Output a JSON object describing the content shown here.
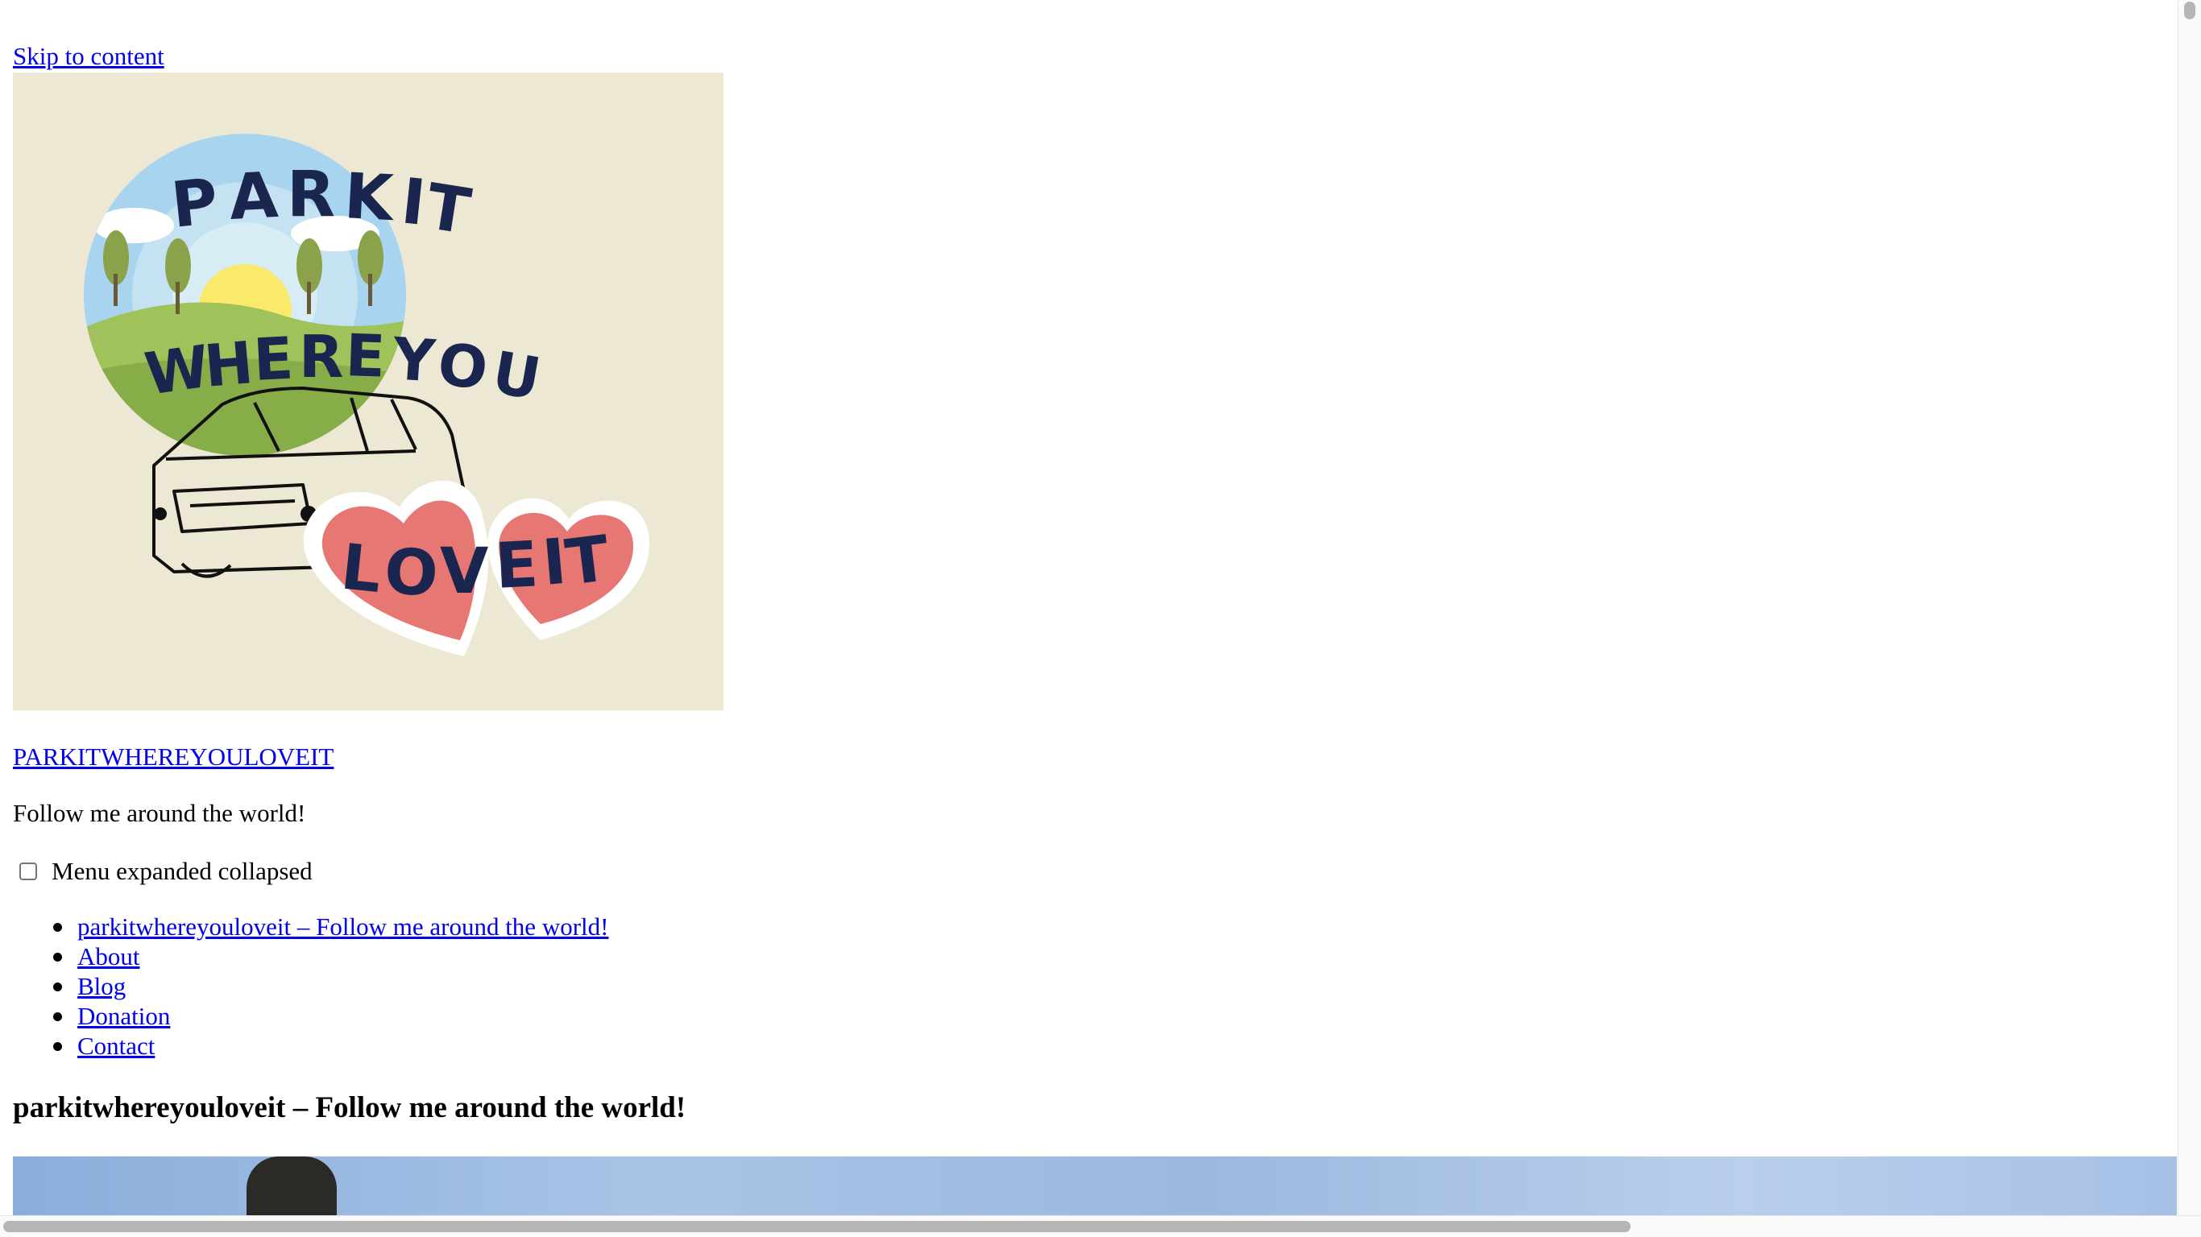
{
  "skip_link": "Skip to content",
  "logo": {
    "words": [
      "PARKIT",
      "WHEREYOU",
      "LOVEIT"
    ],
    "colors": {
      "background": "#ede8d3",
      "text": "#1a2550",
      "heart": "#e77772",
      "sky": "#9ccbea",
      "grass": "#9fc25a",
      "sun": "#fbe96b"
    }
  },
  "site": {
    "title": "PARKITWHEREYOULOVEIT",
    "tagline": "Follow me around the world!"
  },
  "menu_toggle": {
    "label": "Menu expanded collapsed",
    "checked": false
  },
  "nav": {
    "items": [
      {
        "label": "parkitwhereyouloveit – Follow me around the world!"
      },
      {
        "label": "About"
      },
      {
        "label": "Blog"
      },
      {
        "label": "Donation"
      },
      {
        "label": "Contact"
      }
    ]
  },
  "page": {
    "heading": "parkitwhereyouloveit – Follow me around the world!"
  },
  "colors": {
    "link": "#0000ee",
    "text": "#000000"
  }
}
